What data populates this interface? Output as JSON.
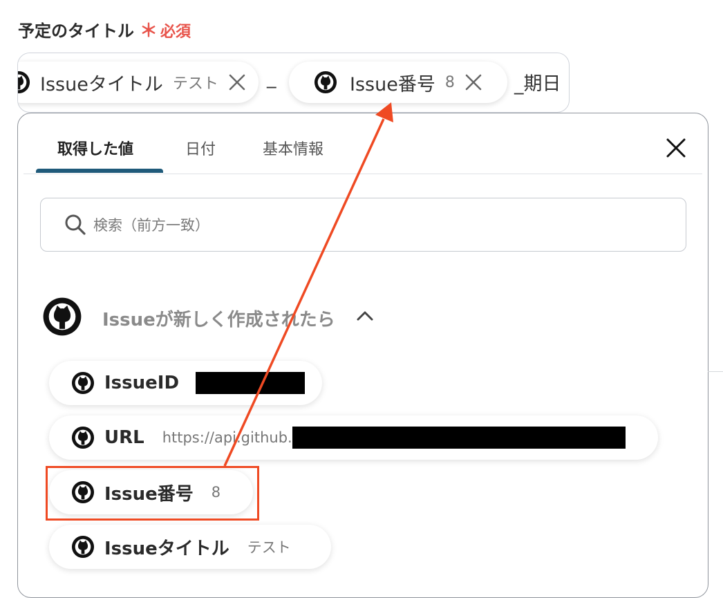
{
  "field": {
    "label": "予定のタイトル",
    "required_star": "＊",
    "required_text": "必須"
  },
  "title_input": {
    "chip1": {
      "label": "Issueタイトル",
      "value": "テスト"
    },
    "sep1": "_",
    "chip2": {
      "label": "Issue番号",
      "value": "8"
    },
    "suffix": "_期日"
  },
  "tabs": [
    {
      "label": "取得した値",
      "active": true
    },
    {
      "label": "日付",
      "active": false
    },
    {
      "label": "基本情報",
      "active": false
    }
  ],
  "search": {
    "placeholder": "検索（前方一致）"
  },
  "section": {
    "title": "Issueが新しく作成されたら",
    "expanded": true
  },
  "items": [
    {
      "label": "IssueID",
      "value": "",
      "redacted": true
    },
    {
      "label": "URL",
      "value": "https://api.github.",
      "redacted": true
    },
    {
      "label": "Issue番号",
      "value": "8",
      "highlighted": true
    },
    {
      "label": "Issueタイトル",
      "value": "テスト"
    }
  ],
  "annotation": {
    "color": "#ef4a23"
  },
  "colors": {
    "required": "#e8544b",
    "tab_active_underline": "#1f5a7a",
    "annotation": "#ef4a23"
  }
}
